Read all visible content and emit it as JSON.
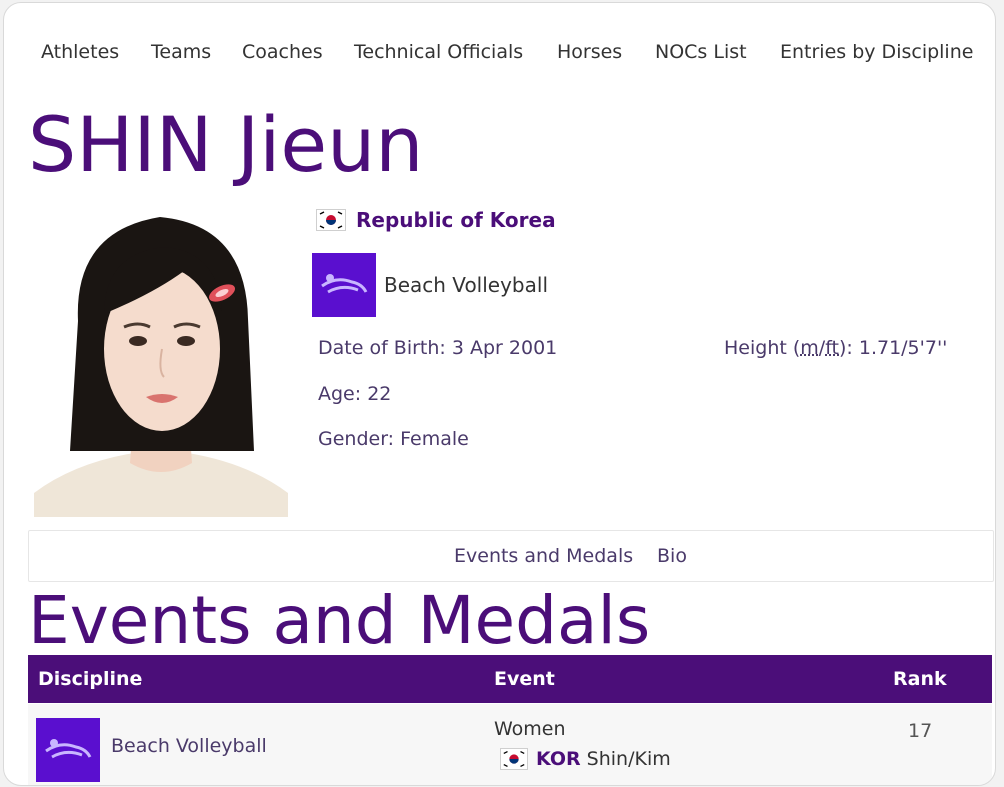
{
  "nav": {
    "items": [
      "Athletes",
      "Teams",
      "Coaches",
      "Technical Officials",
      "Horses",
      "NOCs List",
      "Entries by Discipline"
    ]
  },
  "athlete": {
    "name": "SHIN Jieun",
    "noc_name": "Republic of Korea",
    "discipline": "Beach Volleyball",
    "dob": "Date of Birth: 3 Apr 2001",
    "height_prefix": "Height (",
    "height_unit_m": "m",
    "height_sep": "/",
    "height_unit_ft": "ft",
    "height_value": "): 1.71/5'7''",
    "age": "Age: 22",
    "gender": "Gender: Female"
  },
  "tabs": [
    "Events and Medals",
    "Bio"
  ],
  "section": {
    "title": "Events and Medals"
  },
  "table": {
    "headers": {
      "discipline": "Discipline",
      "event": "Event",
      "rank": "Rank"
    },
    "rows": [
      {
        "discipline": "Beach Volleyball",
        "event": "Women",
        "team_noc": "KOR",
        "team_names": "Shin/Kim",
        "rank": "17"
      }
    ]
  },
  "colors": {
    "brand_purple": "#4b0e79",
    "discipline_tile": "#5a0fcf"
  },
  "icons": [
    "korea-flag-icon",
    "beach-volleyball-icon",
    "athlete-photo"
  ]
}
